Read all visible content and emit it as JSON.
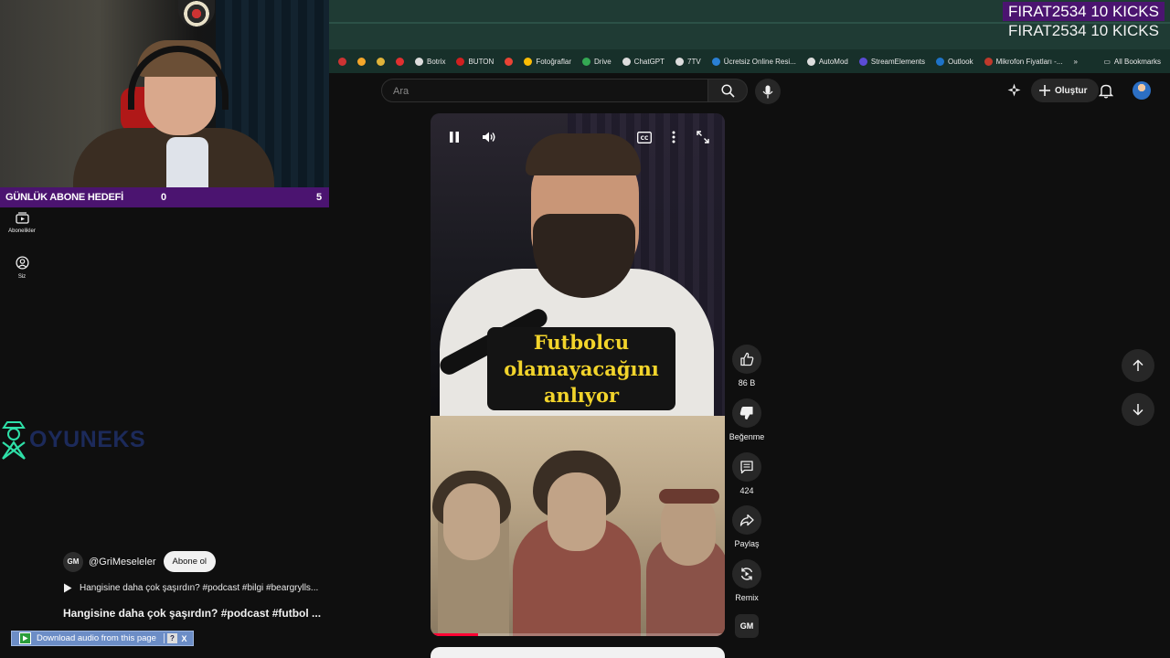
{
  "overlay": {
    "kick_alert_1": "FIRAT2534 10 KICKS",
    "kick_alert_2": "FIRAT2534 10 KICKS"
  },
  "goal_bar": {
    "title": "GÜNLÜK ABONE HEDEFİ",
    "current": "0",
    "target": "5"
  },
  "left_rail": {
    "subscriptions": "Abonelikler",
    "you": "Siz"
  },
  "brand_logo": {
    "text": "OYUNEKS"
  },
  "bookmarks": [
    {
      "label": "",
      "color": "#c33"
    },
    {
      "label": "",
      "color": "#f4a62a"
    },
    {
      "label": "",
      "color": "#e0b33a"
    },
    {
      "label": "",
      "color": "#e03030"
    },
    {
      "label": "Botrix",
      "color": "#dddddd"
    },
    {
      "label": "BUTON",
      "color": "#d02020"
    },
    {
      "label": "",
      "color": "#ea4335"
    },
    {
      "label": "Fotoğraflar",
      "color": "#fbbc04"
    },
    {
      "label": "Drive",
      "color": "#34a853"
    },
    {
      "label": "ChatGPT",
      "color": "#dddddd"
    },
    {
      "label": "7TV",
      "color": "#dddddd"
    },
    {
      "label": "Ücretsiz Online Resi...",
      "color": "#2a7fd4"
    },
    {
      "label": "AutoMod",
      "color": "#dddddd"
    },
    {
      "label": "StreamElements",
      "color": "#5b4bd6"
    },
    {
      "label": "Outlook",
      "color": "#1e73c8"
    },
    {
      "label": "Mikrofon Fiyatları -...",
      "color": "#c0392b"
    }
  ],
  "bookmarks_more": "»",
  "all_bookmarks": "All Bookmarks",
  "search": {
    "placeholder": "Ara"
  },
  "header": {
    "create_label": "Oluştur"
  },
  "video": {
    "caption_line1": "Futbolcu",
    "caption_line2": "olamayacağını",
    "caption_line3": "anlıyor",
    "progress": 0.16
  },
  "actions": {
    "like_count": "86 B",
    "dislike_label": "Beğenme",
    "comment_count": "424",
    "share_label": "Paylaş",
    "remix_label": "Remix"
  },
  "channel": {
    "avatar_text": "GM",
    "handle": "@GriMeseleler",
    "subscribe_label": "Abone ol",
    "playlist_text": "Hangisine daha çok şaşırdın? #podcast #bilgi #beargrylls...",
    "title": "Hangisine daha çok şaşırdın? #podcast #futbol ..."
  },
  "download_bar": {
    "label": "Download audio from this page",
    "help": "?",
    "close": "X"
  },
  "colors": {
    "accent_red": "#ff0033",
    "overlay_purple": "#4b1470",
    "caption_yellow": "#f2d42b",
    "chrome_green": "#1f3b34"
  }
}
